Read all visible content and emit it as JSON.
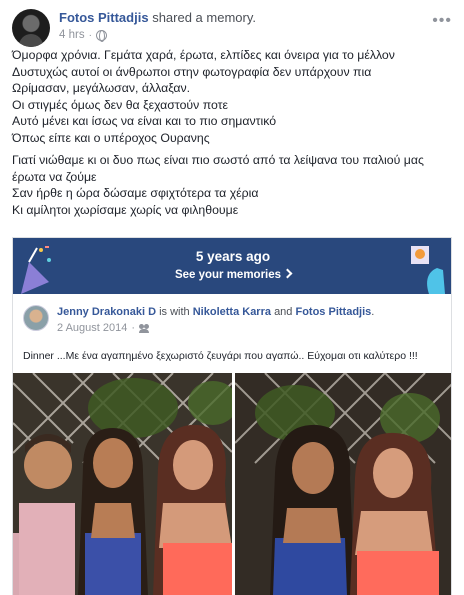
{
  "post": {
    "author": "Fotos Pittadjis",
    "action": "shared a memory.",
    "time": "4 hrs",
    "text": {
      "paragraphs": [
        [
          "Όμορφα χρόνια. Γεμάτα χαρά, έρωτα, ελπίδες και όνειρα για το μέλλον",
          "Δυστυχώς αυτοί οι άνθρωποι στην φωτογραφία δεν υπάρχουν πια",
          "Ωρίμασαν, μεγάλωσαν, άλλαξαν.",
          "Οι στιγμές όμως δεν θα ξεχαστούν ποτε",
          "Αυτό μένει και ίσως να είναι και το πιο σημαντικό",
          "Όπως είπε και ο υπέροχος Ουρανης"
        ],
        [
          "Γιατί νιώθαμε κι οι δυο πως είναι πιο σωστό από τα λείψανα του παλιού μας",
          "έρωτα να ζούμε",
          "Σαν ήρθε η ώρα δώσαμε σφιχτότερα τα χέρια",
          "Κι αμίλητοι χωρίσαμε χωρίς να φιληθουμε"
        ]
      ]
    }
  },
  "memory": {
    "title": "5 years ago",
    "subtitle": "See your memories",
    "banner_color": "#29487d"
  },
  "shared_post": {
    "author": "Jenny Drakonaki D",
    "with_text": "is with",
    "tag1": "Nikoletta Karra",
    "and_text": "and",
    "tag2": "Fotos Pittadjis",
    "end": ".",
    "date": "2 August 2014",
    "text": "Dinner ...Με ένα αγαπημένο ξεχωριστό ζευγάρι που αγαπώ.. Εύχομαι οτι καλύτερο !!!"
  },
  "colors": {
    "link": "#365899",
    "meta": "#90949c",
    "text": "#1d2129"
  }
}
